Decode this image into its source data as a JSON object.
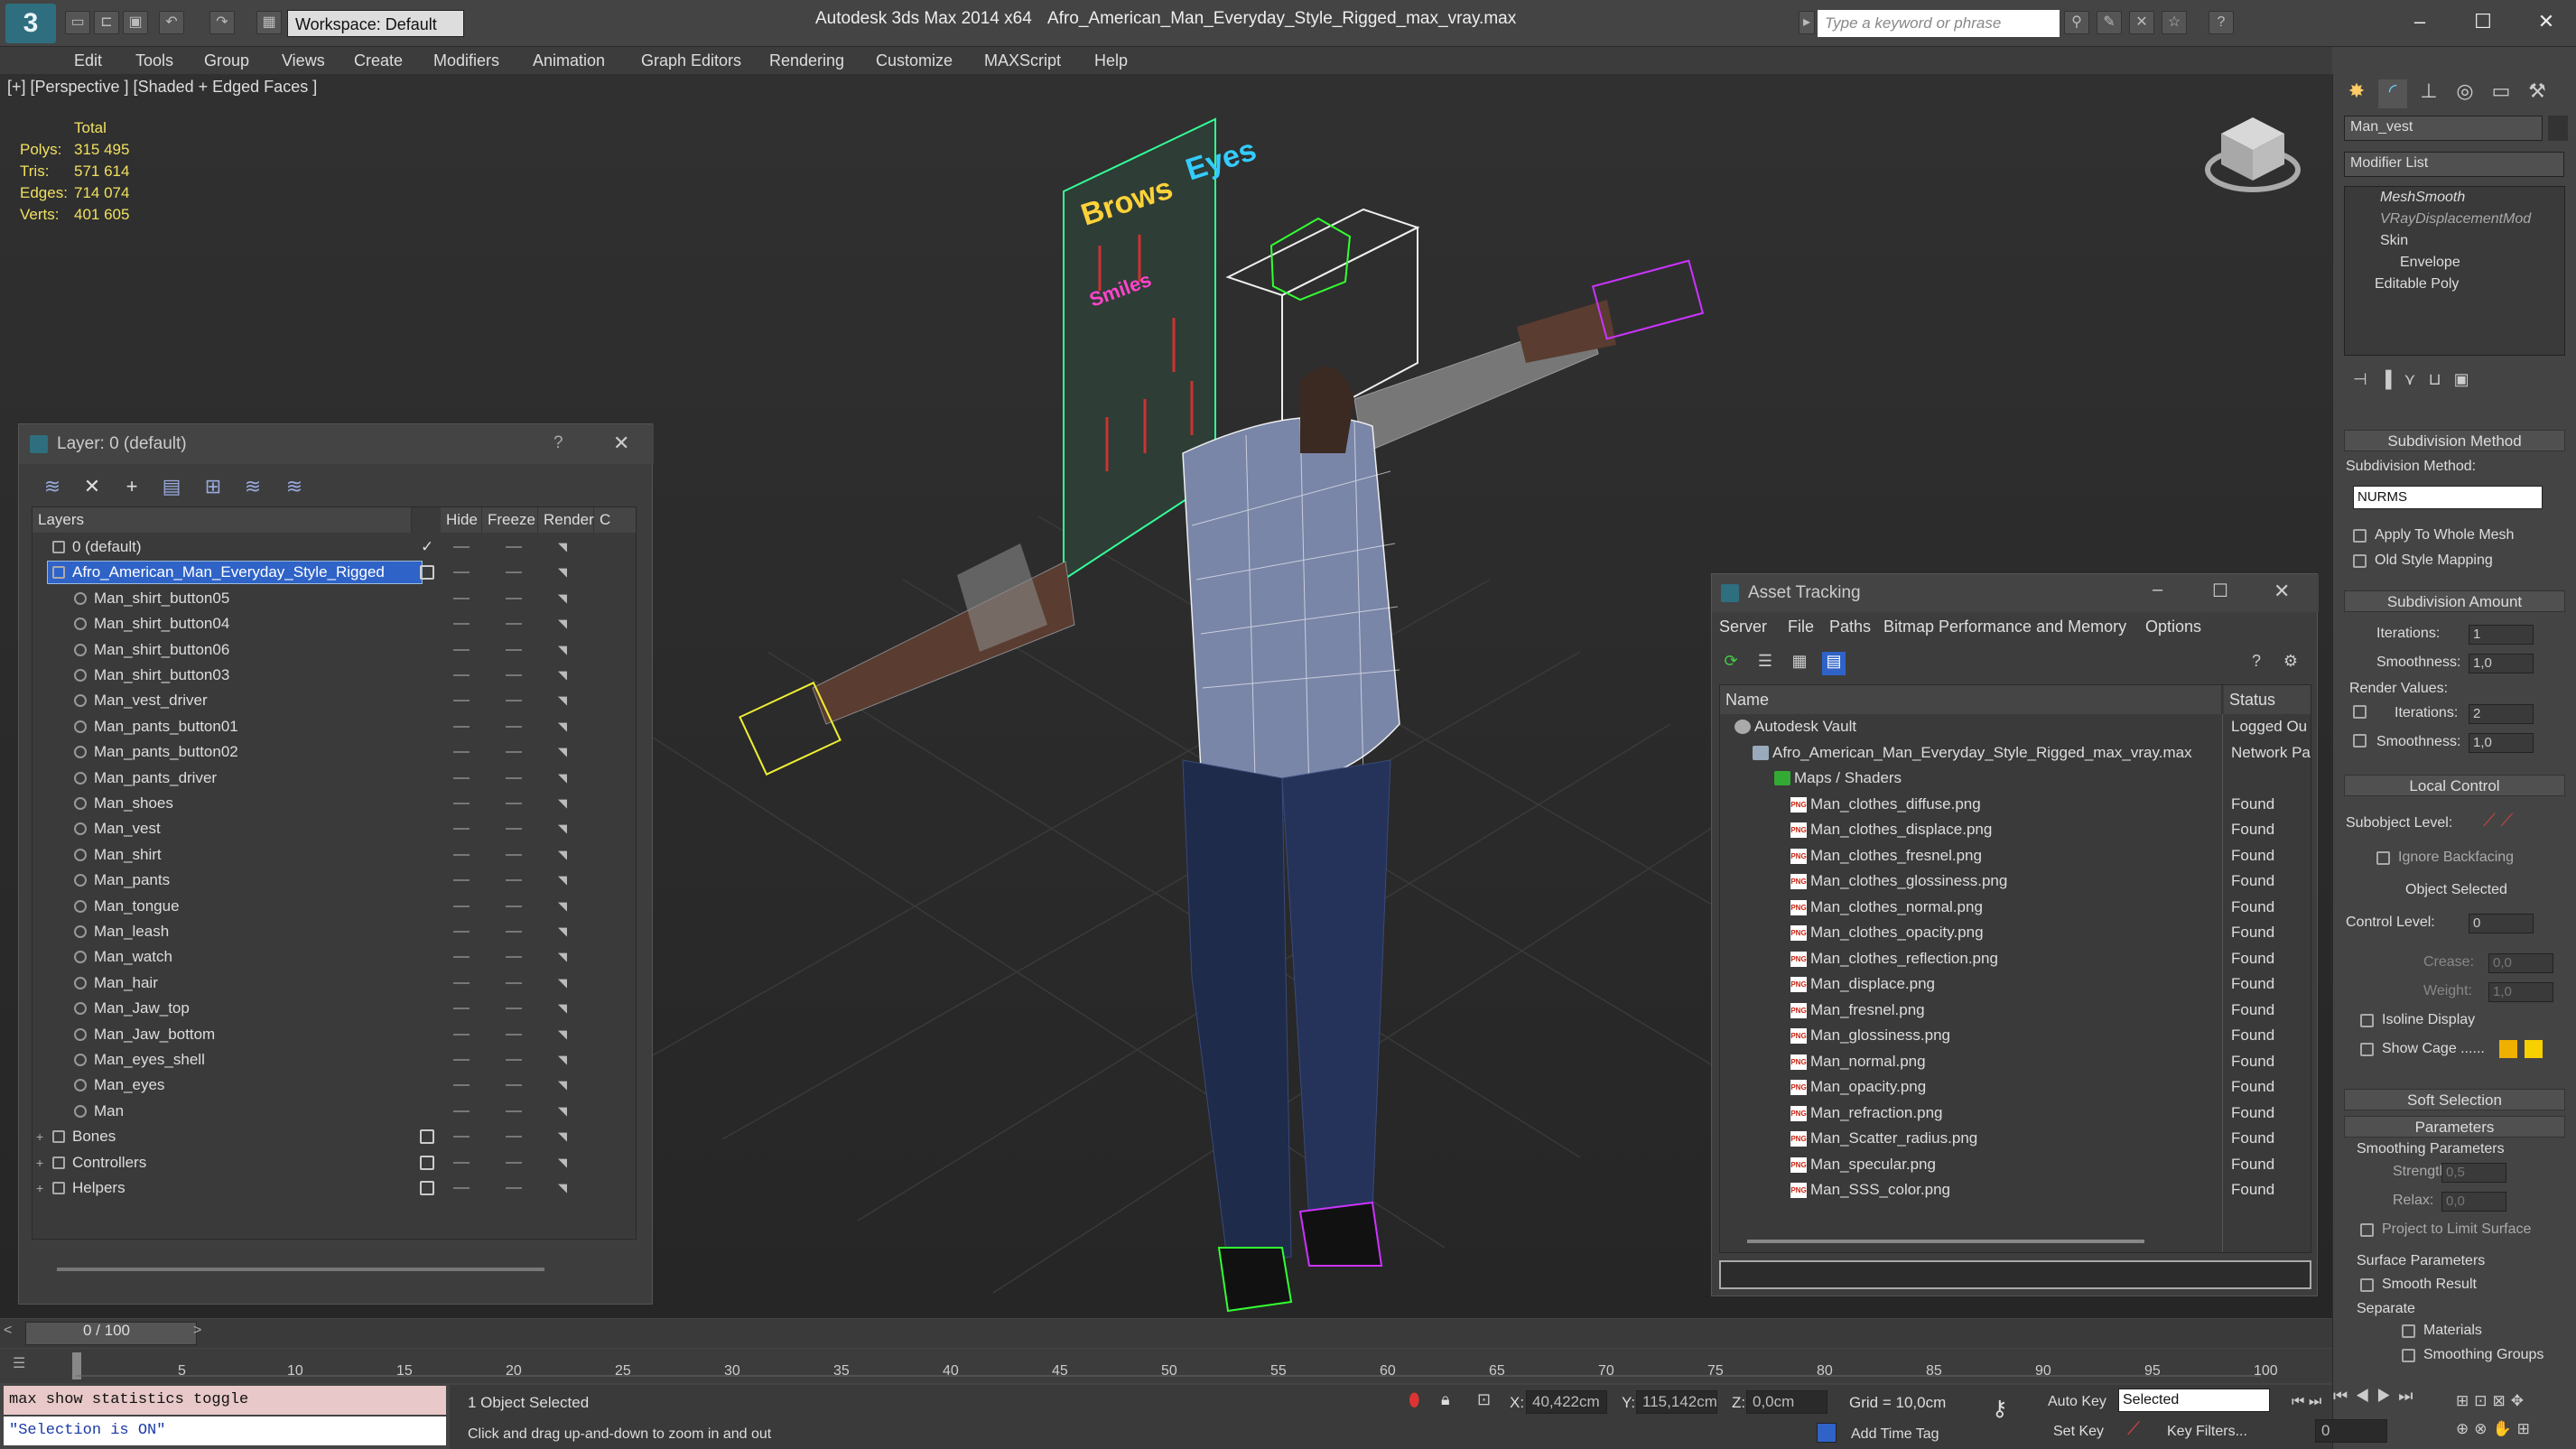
{
  "titlebar": {
    "workspace": "Workspace: Default",
    "app_title": "Autodesk 3ds Max  2014 x64",
    "file_title": "Afro_American_Man_Everyday_Style_Rigged_max_vray.max",
    "search_placeholder": "Type a keyword or phrase"
  },
  "menubar": [
    "Edit",
    "Tools",
    "Group",
    "Views",
    "Create",
    "Modifiers",
    "Animation",
    "Graph Editors",
    "Rendering",
    "Customize",
    "MAXScript",
    "Help"
  ],
  "viewport": {
    "label": "[+] [Perspective ] [Shaded + Edged Faces ]",
    "stats": {
      "header": "Total",
      "rows": [
        {
          "label": "Polys:",
          "value": "315 495"
        },
        {
          "label": "Tris:",
          "value": "571 614"
        },
        {
          "label": "Edges:",
          "value": "714 074"
        },
        {
          "label": "Verts:",
          "value": "401 605"
        }
      ]
    },
    "scene_text": {
      "brows": "Brows",
      "eyes": "Eyes",
      "smiles": "Smiles"
    }
  },
  "layer_window": {
    "title": "Layer: 0 (default)",
    "help": "?",
    "close": "✕",
    "columns": [
      "Layers",
      "Hide",
      "Freeze",
      "Render",
      "C"
    ],
    "rows": [
      {
        "name": "0 (default)",
        "level": 0,
        "type": "layer",
        "checked": true
      },
      {
        "name": "Afro_American_Man_Everyday_Style_Rigged",
        "level": 0,
        "type": "layer",
        "selected": true,
        "box": true
      },
      {
        "name": "Man_shirt_button05",
        "level": 1,
        "type": "object"
      },
      {
        "name": "Man_shirt_button04",
        "level": 1,
        "type": "object"
      },
      {
        "name": "Man_shirt_button06",
        "level": 1,
        "type": "object"
      },
      {
        "name": "Man_shirt_button03",
        "level": 1,
        "type": "object"
      },
      {
        "name": "Man_vest_driver",
        "level": 1,
        "type": "object"
      },
      {
        "name": "Man_pants_button01",
        "level": 1,
        "type": "object"
      },
      {
        "name": "Man_pants_button02",
        "level": 1,
        "type": "object"
      },
      {
        "name": "Man_pants_driver",
        "level": 1,
        "type": "object"
      },
      {
        "name": "Man_shoes",
        "level": 1,
        "type": "object"
      },
      {
        "name": "Man_vest",
        "level": 1,
        "type": "object"
      },
      {
        "name": "Man_shirt",
        "level": 1,
        "type": "object"
      },
      {
        "name": "Man_pants",
        "level": 1,
        "type": "object"
      },
      {
        "name": "Man_tongue",
        "level": 1,
        "type": "object"
      },
      {
        "name": "Man_leash",
        "level": 1,
        "type": "object"
      },
      {
        "name": "Man_watch",
        "level": 1,
        "type": "object"
      },
      {
        "name": "Man_hair",
        "level": 1,
        "type": "object"
      },
      {
        "name": "Man_Jaw_top",
        "level": 1,
        "type": "object"
      },
      {
        "name": "Man_Jaw_bottom",
        "level": 1,
        "type": "object"
      },
      {
        "name": "Man_eyes_shell",
        "level": 1,
        "type": "object"
      },
      {
        "name": "Man_eyes",
        "level": 1,
        "type": "object"
      },
      {
        "name": "Man",
        "level": 1,
        "type": "object"
      },
      {
        "name": "Bones",
        "level": 0,
        "type": "layer",
        "box": true,
        "expander": true
      },
      {
        "name": "Controllers",
        "level": 0,
        "type": "layer",
        "box": true,
        "expander": true
      },
      {
        "name": "Helpers",
        "level": 0,
        "type": "layer",
        "box": true,
        "expander": true
      }
    ]
  },
  "asset_window": {
    "title": "Asset Tracking",
    "menus": [
      "Server",
      "File",
      "Paths",
      "Bitmap Performance and Memory",
      "Options"
    ],
    "columns": [
      "Name",
      "Status"
    ],
    "rows": [
      {
        "name": "Autodesk Vault",
        "status": "Logged Ou",
        "level": 0,
        "icon": "vault"
      },
      {
        "name": "Afro_American_Man_Everyday_Style_Rigged_max_vray.max",
        "status": "Network Pa",
        "level": 1,
        "icon": "file"
      },
      {
        "name": "Maps / Shaders",
        "status": "",
        "level": 2,
        "icon": "maps"
      },
      {
        "name": "Man_clothes_diffuse.png",
        "status": "Found",
        "level": 3,
        "icon": "png"
      },
      {
        "name": "Man_clothes_displace.png",
        "status": "Found",
        "level": 3,
        "icon": "png"
      },
      {
        "name": "Man_clothes_fresnel.png",
        "status": "Found",
        "level": 3,
        "icon": "png"
      },
      {
        "name": "Man_clothes_glossiness.png",
        "status": "Found",
        "level": 3,
        "icon": "png"
      },
      {
        "name": "Man_clothes_normal.png",
        "status": "Found",
        "level": 3,
        "icon": "png"
      },
      {
        "name": "Man_clothes_opacity.png",
        "status": "Found",
        "level": 3,
        "icon": "png"
      },
      {
        "name": "Man_clothes_reflection.png",
        "status": "Found",
        "level": 3,
        "icon": "png"
      },
      {
        "name": "Man_displace.png",
        "status": "Found",
        "level": 3,
        "icon": "png"
      },
      {
        "name": "Man_fresnel.png",
        "status": "Found",
        "level": 3,
        "icon": "png"
      },
      {
        "name": "Man_glossiness.png",
        "status": "Found",
        "level": 3,
        "icon": "png"
      },
      {
        "name": "Man_normal.png",
        "status": "Found",
        "level": 3,
        "icon": "png"
      },
      {
        "name": "Man_opacity.png",
        "status": "Found",
        "level": 3,
        "icon": "png"
      },
      {
        "name": "Man_refraction.png",
        "status": "Found",
        "level": 3,
        "icon": "png"
      },
      {
        "name": "Man_Scatter_radius.png",
        "status": "Found",
        "level": 3,
        "icon": "png"
      },
      {
        "name": "Man_specular.png",
        "status": "Found",
        "level": 3,
        "icon": "png"
      },
      {
        "name": "Man_SSS_color.png",
        "status": "Found",
        "level": 3,
        "icon": "png"
      }
    ]
  },
  "command_panel": {
    "object_name": "Man_vest",
    "modifier_list": "Modifier List",
    "stack": [
      "MeshSmooth",
      "VRayDisplacementMod",
      "Skin",
      "Envelope",
      "Editable Poly"
    ],
    "subdivision_method_title": "Subdivision Method",
    "subdivision_method_label": "Subdivision Method:",
    "subdivision_method_value": "NURMS",
    "apply_whole_mesh": "Apply To Whole Mesh",
    "old_style_mapping": "Old Style Mapping",
    "subdivision_amount_title": "Subdivision Amount",
    "iterations_label": "Iterations:",
    "iterations_value": "1",
    "smoothness_label": "Smoothness:",
    "smoothness_value": "1,0",
    "render_values_label": "Render Values:",
    "render_iterations_value": "2",
    "render_smoothness_value": "1,0",
    "local_control_title": "Local Control",
    "subobject_level_label": "Subobject Level:",
    "ignore_backfacing": "Ignore Backfacing",
    "object_selected": "Object Selected",
    "control_level_label": "Control Level:",
    "control_level_value": "0",
    "crease_label": "Crease:",
    "crease_value": "0,0",
    "weight_label": "Weight:",
    "weight_value": "1,0",
    "isoline_display": "Isoline Display",
    "show_cage": "Show Cage ......",
    "soft_selection_title": "Soft Selection",
    "parameters_title": "Parameters",
    "smoothing_parameters": "Smoothing Parameters",
    "strength_label": "Strength:",
    "strength_value": "0,5",
    "relax_label": "Relax:",
    "relax_value": "0,0",
    "project_limit": "Project to Limit Surface",
    "surface_parameters": "Surface Parameters",
    "smooth_result": "Smooth Result",
    "separate": "Separate",
    "materials": "Materials",
    "smoothing_groups": "Smoothing Groups"
  },
  "timeline": {
    "frame_display": "0 / 100",
    "ticks": [
      "5",
      "10",
      "15",
      "20",
      "25",
      "30",
      "35",
      "40",
      "45",
      "50",
      "55",
      "60",
      "65",
      "70",
      "75",
      "80",
      "85",
      "90",
      "95",
      "100"
    ]
  },
  "statusbar": {
    "script_line1": "max show statistics toggle",
    "script_line2": "\"Selection is ON\"",
    "objects_selected": "1 Object Selected",
    "prompt": "Click and drag up-and-down to zoom in and out",
    "x_label": "X:",
    "x_value": "40,422cm",
    "y_label": "Y:",
    "y_value": "115,142cm",
    "z_label": "Z:",
    "z_value": "0,0cm",
    "grid": "Grid = 10,0cm",
    "add_time_tag": "Add Time Tag",
    "auto_key": "Auto Key",
    "set_key": "Set Key",
    "selected": "Selected",
    "key_filters": "Key Filters...",
    "frame_value": "0"
  },
  "colors": {
    "accent_blue": "#2f63c8",
    "stats_yellow": "#f0e060",
    "status_pink": "#e8c8c8"
  }
}
